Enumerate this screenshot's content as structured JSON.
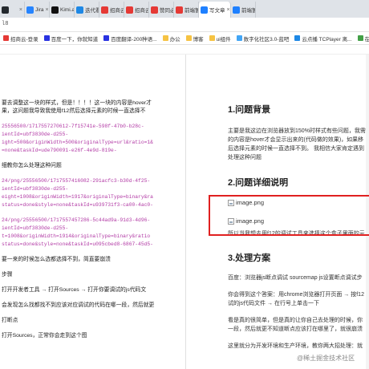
{
  "tabs": [
    {
      "label": "",
      "icon": "github-icon",
      "color": "#24292e"
    },
    {
      "label": "Jira",
      "icon": "jira-icon",
      "color": "#2684ff"
    },
    {
      "label": "Kimi.ai",
      "icon": "kimi-icon",
      "color": "#111111"
    },
    {
      "label": "迭代看板",
      "icon": "board-icon",
      "color": "#1e88e5"
    },
    {
      "label": "招商云",
      "icon": "cloud-icon",
      "color": "#e53935"
    },
    {
      "label": "招商云",
      "icon": "cloud-icon",
      "color": "#e53935"
    },
    {
      "label": "赞同必读",
      "icon": "c-icon",
      "color": "#e53935"
    },
    {
      "label": "前端暂",
      "icon": "c-icon",
      "color": "#e53935"
    },
    {
      "label": "写文章",
      "icon": "juejin-icon",
      "color": "#1e80ff",
      "active": true
    },
    {
      "label": "前端暂",
      "icon": "juejin-icon",
      "color": "#1e80ff"
    }
  ],
  "address": "l8",
  "bookmarks": [
    {
      "label": "招商云-登录",
      "color": "#e53935"
    },
    {
      "label": "百度一下，你就知道",
      "color": "#2932e1"
    },
    {
      "label": "百度翻译-200种语...",
      "color": "#2932e1"
    },
    {
      "label": "办公",
      "color": "#f6c343"
    },
    {
      "label": "博客",
      "color": "#f6c343"
    },
    {
      "label": "ui组件",
      "color": "#f6c343"
    },
    {
      "label": "数字化社区3.0-蓝吧",
      "color": "#42a5f5"
    },
    {
      "label": "云点播 TCPlayer 离...",
      "color": "#1e88e5"
    },
    {
      "label": "在线鸭豆",
      "color": "#43a047"
    }
  ],
  "editor_lines": [
    {
      "text": "要去调整这一块的样式，但是！！！！这一块的内容是hover才",
      "kind": "text"
    },
    {
      "text": "果，这问题我导致我使用f12然后选择元素的时候一直选择不",
      "kind": "text"
    },
    {
      "text": "",
      "kind": "gap"
    },
    {
      "text": "25556500/1717557270612-7f15741e-598f-47b0-b28c-",
      "kind": "code"
    },
    {
      "text": "ientId=ubf3830de-d255-",
      "kind": "code"
    },
    {
      "text": "ight=500&originWidth=500&originalType=url&ratio=1&",
      "kind": "code"
    },
    {
      "text": "=none&taskId=ude790091-e26f-4e9d-819e-",
      "kind": "code"
    },
    {
      "text": "",
      "kind": "gap"
    },
    {
      "text": "细教你怎么处理这种问题",
      "kind": "text"
    },
    {
      "text": "",
      "kind": "gap"
    },
    {
      "text": "24/png/25556500/1717557416082-291acfc3-b30d-4f25-",
      "kind": "code"
    },
    {
      "text": "ientId=ubf3830de-d255-",
      "kind": "code"
    },
    {
      "text": "eight=1008&originWidth=1917&originalType=binary&ra",
      "kind": "code"
    },
    {
      "text": "status=done&style=none&taskId=u939731f3-ca00-4ac0-",
      "kind": "code"
    },
    {
      "text": "",
      "kind": "gap"
    },
    {
      "text": "24/png/25556500/1717557457286-5c44ad9a-91d3-4d96-",
      "kind": "code"
    },
    {
      "text": "ientId=ubf3830de-d255-",
      "kind": "code"
    },
    {
      "text": "t=1008&originWidth=1914&originalType=binary&ratio",
      "kind": "code"
    },
    {
      "text": "status=done&style=none&taskId=u095cbed8-6867-45d5-",
      "kind": "code"
    },
    {
      "text": "",
      "kind": "gap"
    },
    {
      "text": "要一来的时候怎么选都选择不到，简直要崩溃",
      "kind": "text"
    },
    {
      "text": "",
      "kind": "gap"
    },
    {
      "text": "步骤",
      "kind": "text"
    },
    {
      "text": "",
      "kind": "gap"
    },
    {
      "text": "打开开发者工具 → 打开Sources → 打开你要调试的js代码文",
      "kind": "text"
    },
    {
      "text": "",
      "kind": "gap"
    },
    {
      "text": "会发现怎么找都找不到应该对应调试的代码在哪一段，然后就更",
      "kind": "text"
    },
    {
      "text": "",
      "kind": "gap"
    },
    {
      "text": "打断点",
      "kind": "text"
    },
    {
      "text": "",
      "kind": "gap"
    },
    {
      "text": "打开Sources，正常你会走到这个图",
      "kind": "text"
    }
  ],
  "preview": {
    "h1": "1.问题背景",
    "p1a": "主要是我这边在浏览器放到150%时样式有些问题，我需",
    "p1b": "的内容是hover才会显示出来的(代码做的效果)，如果移",
    "p1c": "后选择元素的时候一直选择不到。 我相信大家肯定遇到",
    "p1d": "处理这种问题",
    "h2": "2.问题详细说明",
    "img1": "image.png",
    "img2": "image.png",
    "p2": "所以当我想去用f12的调试工具来选择这个盒子里面的元",
    "h3": "3.处理方案",
    "p3a": "百度：浏览器js断点调试 sourcemap js设置断点调试步",
    "p3b": "你会得到这个答案：用chrome浏览器打开页面 → 按f12",
    "p3c": "试的js代码文件 → 在行号上单击一下",
    "p3d": "看是真的很简单，但是真的让你自己去处理的时候，你",
    "p3e": "一段，然后就更不知道断点应该打在哪里了，就很崩溃",
    "p3f": "这里就分为开发环境和生产环境，教你两大招处理：就"
  },
  "watermark": "@稀土掘金技术社区"
}
